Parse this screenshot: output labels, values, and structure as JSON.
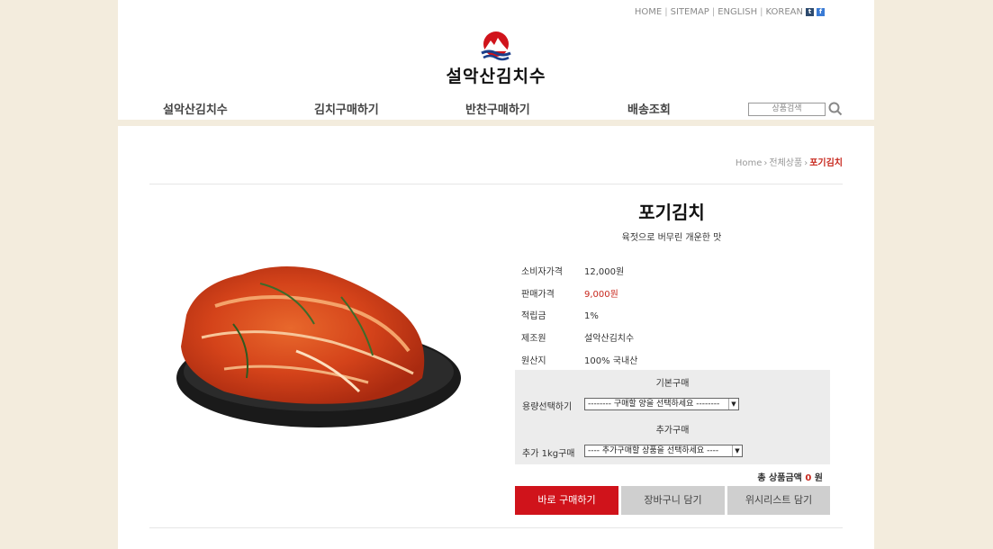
{
  "top_links": [
    "HOME",
    "SITEMAP",
    "ENGLISH",
    "KOREAN"
  ],
  "sns": {
    "tistory": "t",
    "facebook": "f"
  },
  "logo": {
    "text": "설악산김치수"
  },
  "nav": [
    "설악산김치수",
    "김치구매하기",
    "반찬구매하기",
    "배송조회"
  ],
  "search": {
    "placeholder": "상품검색"
  },
  "breadcrumb": {
    "home": "Home",
    "category": "전체상품",
    "current": "포기김치"
  },
  "product": {
    "title": "포기김치",
    "subtitle": "육젓으로 버무린 개운한 맛",
    "rows": [
      {
        "label": "소비자가격",
        "value": "12,000원"
      },
      {
        "label": "판매가격",
        "value": "9,000원"
      },
      {
        "label": "적립금",
        "value": "1%"
      },
      {
        "label": "제조원",
        "value": "설악산김치수"
      },
      {
        "label": "원산지",
        "value": "100% 국내산"
      }
    ]
  },
  "purchase": {
    "basic_heading": "기본구매",
    "basic_label": "용량선택하기",
    "basic_select": "-------- 구매할 양을 선택하세요 --------",
    "extra_heading": "추가구매",
    "extra_label": "추가 1kg구매",
    "extra_select": "---- 추가구매할 상품을 선택하세요 ----",
    "total_label": "총 상품금액",
    "total_value": "0",
    "total_unit": "원"
  },
  "buttons": {
    "buy_now": "바로 구매하기",
    "cart": "장바구니 담기",
    "wishlist": "위시리스트 담기"
  },
  "colors": {
    "accent": "#d0131b",
    "background": "#f3ecdd"
  }
}
